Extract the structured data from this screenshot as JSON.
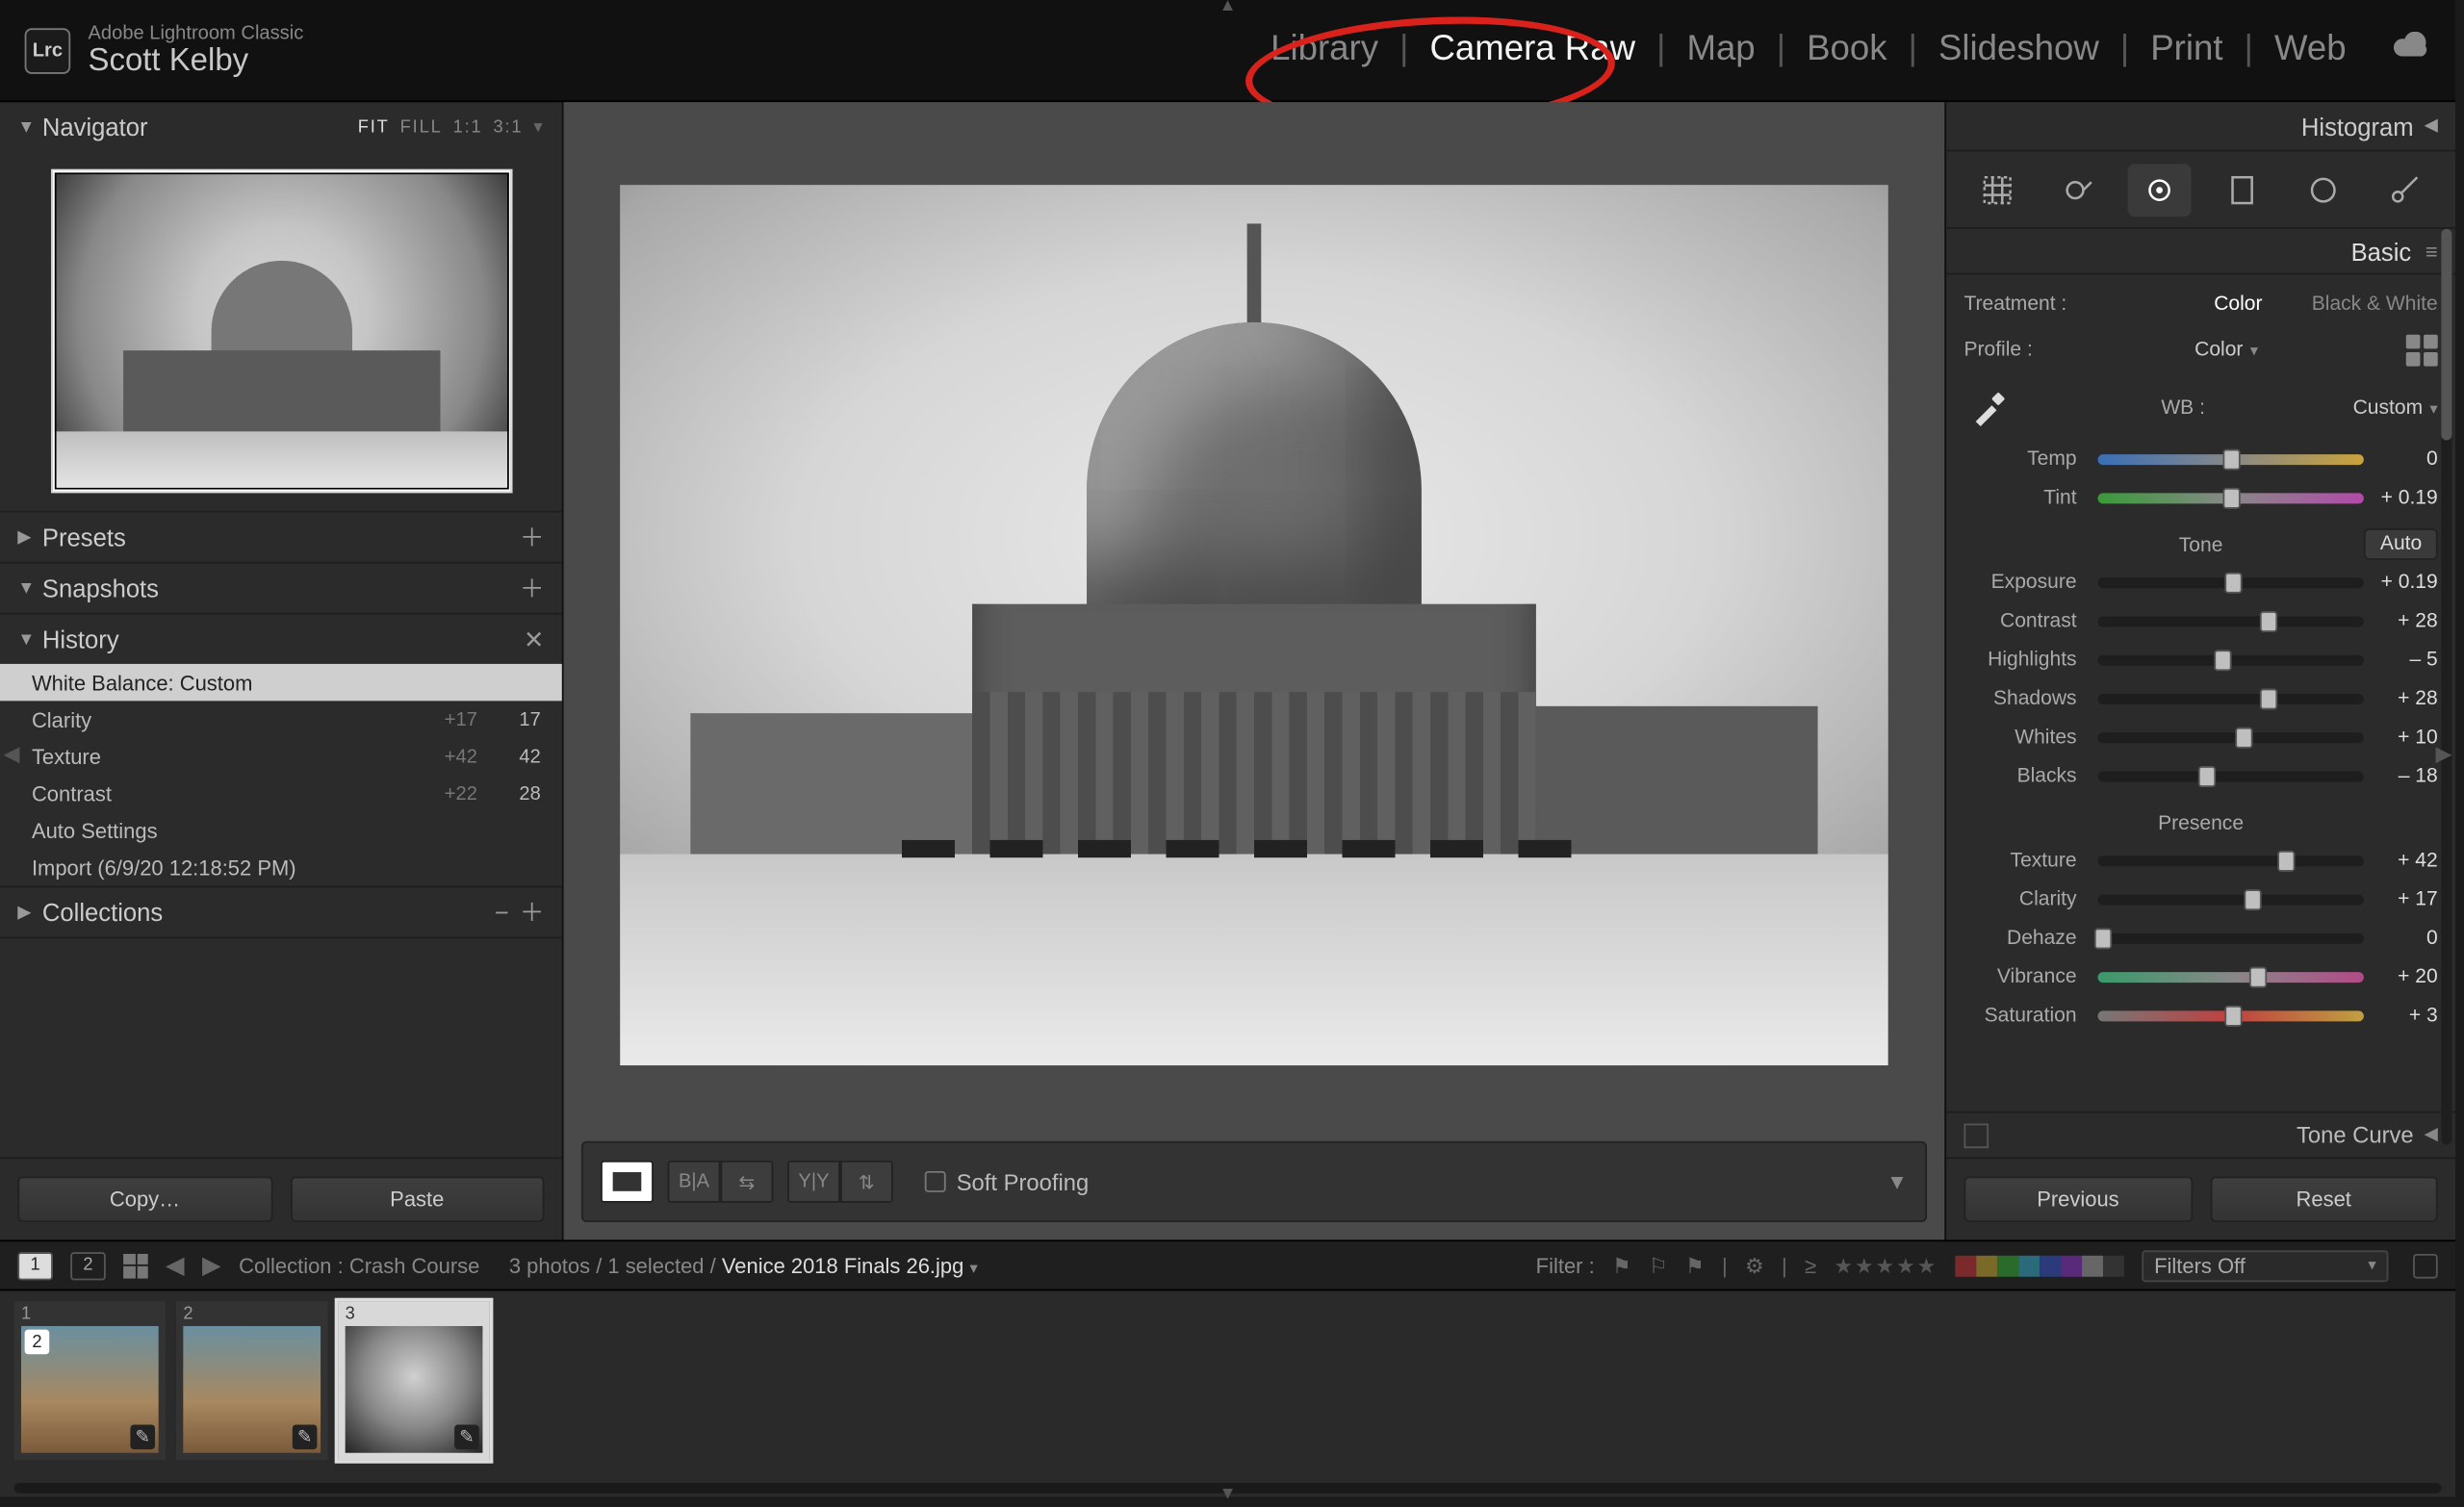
{
  "brand": {
    "product": "Adobe Lightroom Classic",
    "user": "Scott Kelby",
    "logo": "Lrc"
  },
  "modules": {
    "items": [
      "Library",
      "Camera Raw",
      "Map",
      "Book",
      "Slideshow",
      "Print",
      "Web"
    ],
    "active_index": 1
  },
  "left": {
    "navigator": {
      "title": "Navigator",
      "zoom_modes": [
        "FIT",
        "FILL",
        "1:1",
        "3:1"
      ],
      "zoom_active": 0
    },
    "presets": {
      "title": "Presets"
    },
    "snapshots": {
      "title": "Snapshots"
    },
    "history": {
      "title": "History",
      "items": [
        {
          "name": "White Balance: Custom",
          "prev": "",
          "val": "",
          "selected": true
        },
        {
          "name": "Clarity",
          "prev": "+17",
          "val": "17",
          "selected": false
        },
        {
          "name": "Texture",
          "prev": "+42",
          "val": "42",
          "selected": false
        },
        {
          "name": "Contrast",
          "prev": "+22",
          "val": "28",
          "selected": false
        },
        {
          "name": "Auto Settings",
          "prev": "",
          "val": "",
          "selected": false
        },
        {
          "name": "Import (6/9/20 12:18:52 PM)",
          "prev": "",
          "val": "",
          "selected": false
        }
      ]
    },
    "collections": {
      "title": "Collections"
    },
    "buttons": {
      "copy": "Copy…",
      "paste": "Paste"
    }
  },
  "center": {
    "toolbar": {
      "soft_proofing": "Soft Proofing",
      "soft_checked": false
    }
  },
  "right": {
    "histogram": {
      "title": "Histogram"
    },
    "tools": [
      "crop",
      "spot",
      "redeye",
      "graduated",
      "radial",
      "brush"
    ],
    "basic": {
      "title": "Basic",
      "treatment_label": "Treatment :",
      "treatment_options": [
        "Color",
        "Black & White"
      ],
      "treatment_selected": 0,
      "profile_label": "Profile :",
      "profile_value": "Color",
      "wb_label": "WB :",
      "wb_value": "Custom",
      "sliders": {
        "temp": {
          "label": "Temp",
          "value": "0",
          "pos": 50
        },
        "tint": {
          "label": "Tint",
          "value": "+ 0.19",
          "pos": 50
        },
        "exposure": {
          "label": "Exposure",
          "value": "+ 0.19",
          "pos": 51
        },
        "contrast": {
          "label": "Contrast",
          "value": "+ 28",
          "pos": 64
        },
        "highlights": {
          "label": "Highlights",
          "value": "– 5",
          "pos": 47
        },
        "shadows": {
          "label": "Shadows",
          "value": "+ 28",
          "pos": 64
        },
        "whites": {
          "label": "Whites",
          "value": "+ 10",
          "pos": 55
        },
        "blacks": {
          "label": "Blacks",
          "value": "– 18",
          "pos": 41
        },
        "texture": {
          "label": "Texture",
          "value": "+ 42",
          "pos": 71
        },
        "clarity": {
          "label": "Clarity",
          "value": "+ 17",
          "pos": 58
        },
        "dehaze": {
          "label": "Dehaze",
          "value": "0",
          "pos": 2
        },
        "vibrance": {
          "label": "Vibrance",
          "value": "+ 20",
          "pos": 60
        },
        "saturation": {
          "label": "Saturation",
          "value": "+ 3",
          "pos": 51
        }
      },
      "tone_heading": "Tone",
      "auto_label": "Auto",
      "presence_heading": "Presence"
    },
    "tonecurve": {
      "title": "Tone Curve"
    },
    "buttons": {
      "previous": "Previous",
      "reset": "Reset"
    }
  },
  "secbar": {
    "pages": [
      "1",
      "2"
    ],
    "collection_label": "Collection :",
    "collection_name": "Crash Course",
    "counts": "3 photos / 1 selected /",
    "filename": "Venice 2018 Finals 26.jpg",
    "filter_label": "Filter :",
    "filters_off": "Filters Off",
    "swatch_colors": [
      "#7a2a2a",
      "#7a6a2a",
      "#2a6a2a",
      "#2a6a7a",
      "#2a3a7a",
      "#5a2a7a",
      "#666",
      "#333"
    ]
  },
  "filmstrip": {
    "thumbs": [
      {
        "n": "1",
        "bw": false,
        "selected": false,
        "badge_n": "2",
        "badge_e": true
      },
      {
        "n": "2",
        "bw": false,
        "selected": false,
        "badge_n": "",
        "badge_e": true
      },
      {
        "n": "3",
        "bw": true,
        "selected": true,
        "badge_n": "",
        "badge_e": true
      }
    ]
  }
}
